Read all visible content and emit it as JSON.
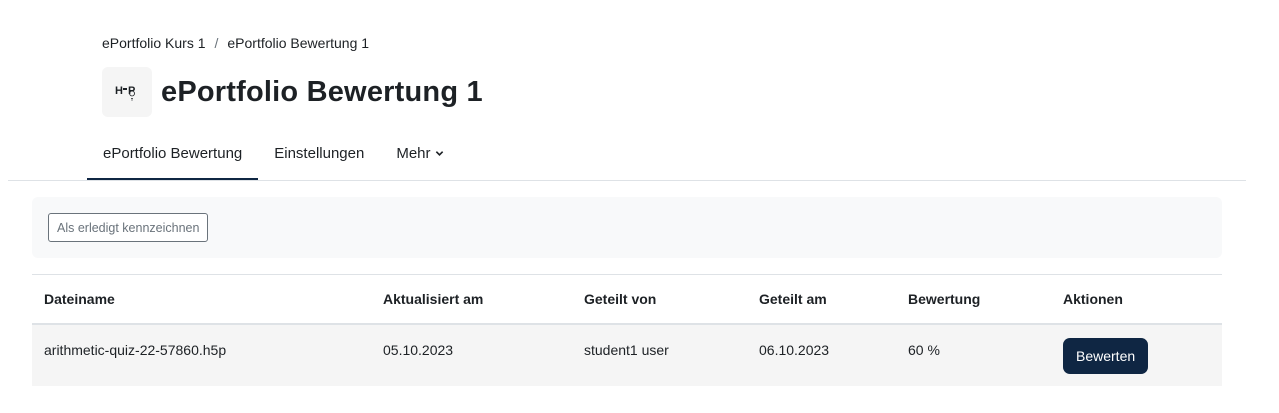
{
  "breadcrumb": {
    "items": [
      "ePortfolio Kurs 1",
      "ePortfolio Bewertung 1"
    ],
    "separator": "/"
  },
  "header": {
    "icon": "h5p-icon",
    "title": "ePortfolio Bewertung 1"
  },
  "tabs": [
    {
      "label": "ePortfolio Bewertung",
      "active": true
    },
    {
      "label": "Einstellungen",
      "active": false
    },
    {
      "label": "Mehr",
      "active": false,
      "icon": "chevron-down-icon"
    }
  ],
  "actionbar": {
    "mark_done_label": "Als erledigt kennzeichnen"
  },
  "table": {
    "headers": [
      "Dateiname",
      "Aktualisiert am",
      "Geteilt von",
      "Geteilt am",
      "Bewertung",
      "Aktionen"
    ],
    "rows": [
      {
        "filename": "arithmetic-quiz-22-57860.h5p",
        "updated": "05.10.2023",
        "shared_by": "student1 user",
        "shared_on": "06.10.2023",
        "grade": "60 %",
        "action": "Bewerten"
      }
    ]
  },
  "colors": {
    "primary": "#0f2643",
    "text": "#1d2125",
    "muted": "#6a737b"
  }
}
